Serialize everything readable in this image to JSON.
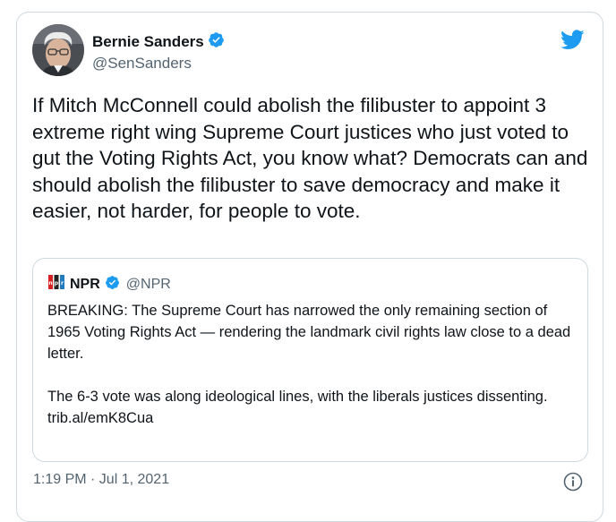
{
  "author": {
    "name": "Bernie Sanders",
    "handle": "@SenSanders",
    "verified": true
  },
  "tweet": {
    "text": "If Mitch McConnell could abolish the filibuster to appoint 3 extreme right wing Supreme Court justices who just voted to gut the Voting Rights Act, you know what? Democrats can and should abolish the filibuster to save democracy and make it easier, not harder, for people to vote."
  },
  "quoted_tweet": {
    "name": "NPR",
    "handle": "@NPR",
    "verified": true,
    "paragraph1": "BREAKING: The Supreme Court has narrowed the only remaining section of 1965 Voting Rights Act — rendering the landmark civil rights law close to a dead letter.",
    "paragraph2": "The 6-3 vote was along ideological lines, with the liberals justices dissenting.",
    "link": "trib.al/emK8Cua"
  },
  "timestamp": "1:19 PM · Jul 1, 2021",
  "icons": {
    "brand": "twitter-bird-icon",
    "verified": "verified-badge-icon",
    "info": "info-icon"
  },
  "colors": {
    "accent": "#1d9bf0",
    "text": "#0f1419",
    "secondary_text": "#536471",
    "border": "#cfd9de"
  }
}
